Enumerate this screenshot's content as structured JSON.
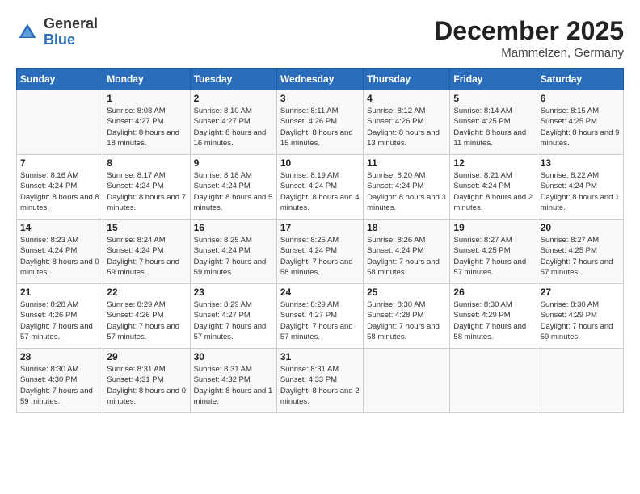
{
  "header": {
    "logo_general": "General",
    "logo_blue": "Blue",
    "month_title": "December 2025",
    "location": "Mammelzen, Germany"
  },
  "days_of_week": [
    "Sunday",
    "Monday",
    "Tuesday",
    "Wednesday",
    "Thursday",
    "Friday",
    "Saturday"
  ],
  "weeks": [
    [
      {
        "day": "",
        "info": ""
      },
      {
        "day": "1",
        "info": "Sunrise: 8:08 AM\nSunset: 4:27 PM\nDaylight: 8 hours\nand 18 minutes."
      },
      {
        "day": "2",
        "info": "Sunrise: 8:10 AM\nSunset: 4:27 PM\nDaylight: 8 hours\nand 16 minutes."
      },
      {
        "day": "3",
        "info": "Sunrise: 8:11 AM\nSunset: 4:26 PM\nDaylight: 8 hours\nand 15 minutes."
      },
      {
        "day": "4",
        "info": "Sunrise: 8:12 AM\nSunset: 4:26 PM\nDaylight: 8 hours\nand 13 minutes."
      },
      {
        "day": "5",
        "info": "Sunrise: 8:14 AM\nSunset: 4:25 PM\nDaylight: 8 hours\nand 11 minutes."
      },
      {
        "day": "6",
        "info": "Sunrise: 8:15 AM\nSunset: 4:25 PM\nDaylight: 8 hours\nand 9 minutes."
      }
    ],
    [
      {
        "day": "7",
        "info": "Sunrise: 8:16 AM\nSunset: 4:24 PM\nDaylight: 8 hours\nand 8 minutes."
      },
      {
        "day": "8",
        "info": "Sunrise: 8:17 AM\nSunset: 4:24 PM\nDaylight: 8 hours\nand 7 minutes."
      },
      {
        "day": "9",
        "info": "Sunrise: 8:18 AM\nSunset: 4:24 PM\nDaylight: 8 hours\nand 5 minutes."
      },
      {
        "day": "10",
        "info": "Sunrise: 8:19 AM\nSunset: 4:24 PM\nDaylight: 8 hours\nand 4 minutes."
      },
      {
        "day": "11",
        "info": "Sunrise: 8:20 AM\nSunset: 4:24 PM\nDaylight: 8 hours\nand 3 minutes."
      },
      {
        "day": "12",
        "info": "Sunrise: 8:21 AM\nSunset: 4:24 PM\nDaylight: 8 hours\nand 2 minutes."
      },
      {
        "day": "13",
        "info": "Sunrise: 8:22 AM\nSunset: 4:24 PM\nDaylight: 8 hours\nand 1 minute."
      }
    ],
    [
      {
        "day": "14",
        "info": "Sunrise: 8:23 AM\nSunset: 4:24 PM\nDaylight: 8 hours\nand 0 minutes."
      },
      {
        "day": "15",
        "info": "Sunrise: 8:24 AM\nSunset: 4:24 PM\nDaylight: 7 hours\nand 59 minutes."
      },
      {
        "day": "16",
        "info": "Sunrise: 8:25 AM\nSunset: 4:24 PM\nDaylight: 7 hours\nand 59 minutes."
      },
      {
        "day": "17",
        "info": "Sunrise: 8:25 AM\nSunset: 4:24 PM\nDaylight: 7 hours\nand 58 minutes."
      },
      {
        "day": "18",
        "info": "Sunrise: 8:26 AM\nSunset: 4:24 PM\nDaylight: 7 hours\nand 58 minutes."
      },
      {
        "day": "19",
        "info": "Sunrise: 8:27 AM\nSunset: 4:25 PM\nDaylight: 7 hours\nand 57 minutes."
      },
      {
        "day": "20",
        "info": "Sunrise: 8:27 AM\nSunset: 4:25 PM\nDaylight: 7 hours\nand 57 minutes."
      }
    ],
    [
      {
        "day": "21",
        "info": "Sunrise: 8:28 AM\nSunset: 4:26 PM\nDaylight: 7 hours\nand 57 minutes."
      },
      {
        "day": "22",
        "info": "Sunrise: 8:29 AM\nSunset: 4:26 PM\nDaylight: 7 hours\nand 57 minutes."
      },
      {
        "day": "23",
        "info": "Sunrise: 8:29 AM\nSunset: 4:27 PM\nDaylight: 7 hours\nand 57 minutes."
      },
      {
        "day": "24",
        "info": "Sunrise: 8:29 AM\nSunset: 4:27 PM\nDaylight: 7 hours\nand 57 minutes."
      },
      {
        "day": "25",
        "info": "Sunrise: 8:30 AM\nSunset: 4:28 PM\nDaylight: 7 hours\nand 58 minutes."
      },
      {
        "day": "26",
        "info": "Sunrise: 8:30 AM\nSunset: 4:29 PM\nDaylight: 7 hours\nand 58 minutes."
      },
      {
        "day": "27",
        "info": "Sunrise: 8:30 AM\nSunset: 4:29 PM\nDaylight: 7 hours\nand 59 minutes."
      }
    ],
    [
      {
        "day": "28",
        "info": "Sunrise: 8:30 AM\nSunset: 4:30 PM\nDaylight: 7 hours\nand 59 minutes."
      },
      {
        "day": "29",
        "info": "Sunrise: 8:31 AM\nSunset: 4:31 PM\nDaylight: 8 hours\nand 0 minutes."
      },
      {
        "day": "30",
        "info": "Sunrise: 8:31 AM\nSunset: 4:32 PM\nDaylight: 8 hours\nand 1 minute."
      },
      {
        "day": "31",
        "info": "Sunrise: 8:31 AM\nSunset: 4:33 PM\nDaylight: 8 hours\nand 2 minutes."
      },
      {
        "day": "",
        "info": ""
      },
      {
        "day": "",
        "info": ""
      },
      {
        "day": "",
        "info": ""
      }
    ]
  ]
}
